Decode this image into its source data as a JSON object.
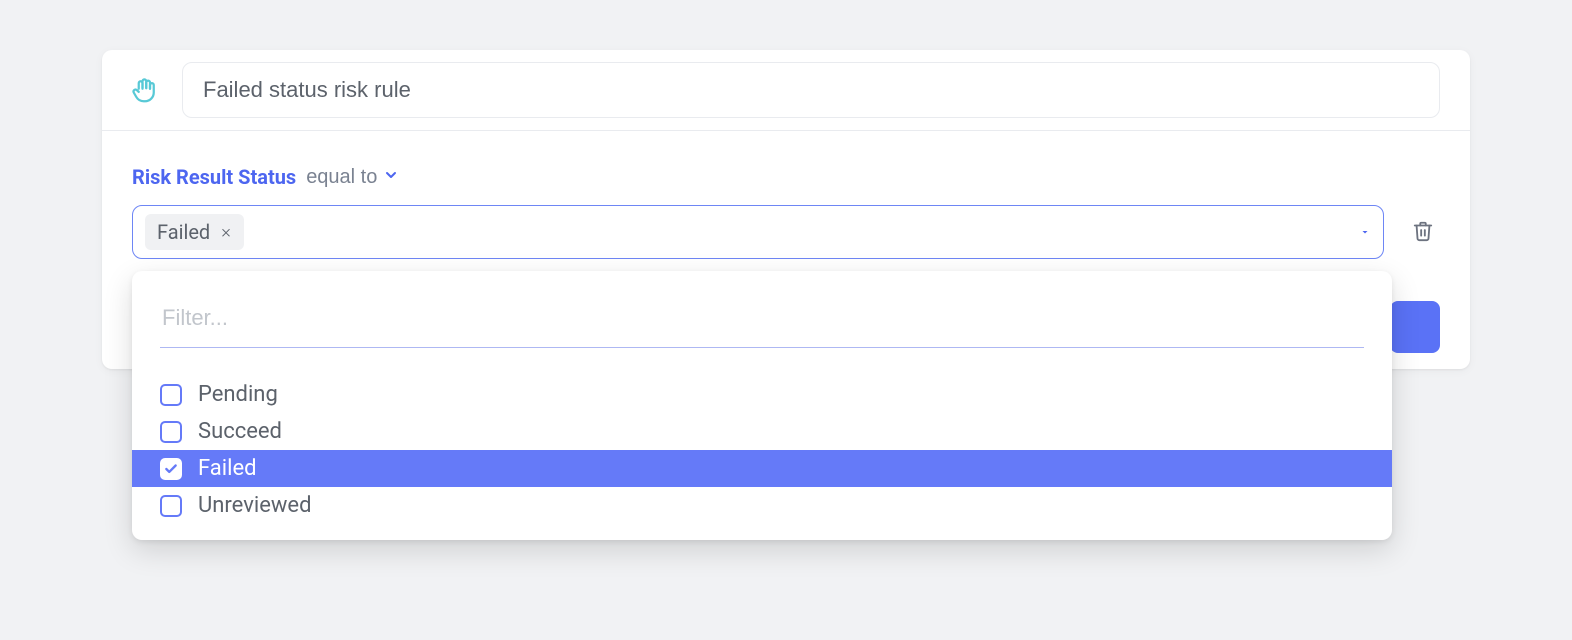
{
  "header": {
    "title_value": "Failed status risk rule",
    "icon": "hand-icon"
  },
  "rule": {
    "field_label": "Risk Result Status",
    "operator_label": "equal to",
    "selected_chip": "Failed"
  },
  "dropdown": {
    "filter_placeholder": "Filter...",
    "options": [
      {
        "label": "Pending",
        "checked": false
      },
      {
        "label": "Succeed",
        "checked": false
      },
      {
        "label": "Failed",
        "checked": true
      },
      {
        "label": "Unreviewed",
        "checked": false
      }
    ]
  }
}
